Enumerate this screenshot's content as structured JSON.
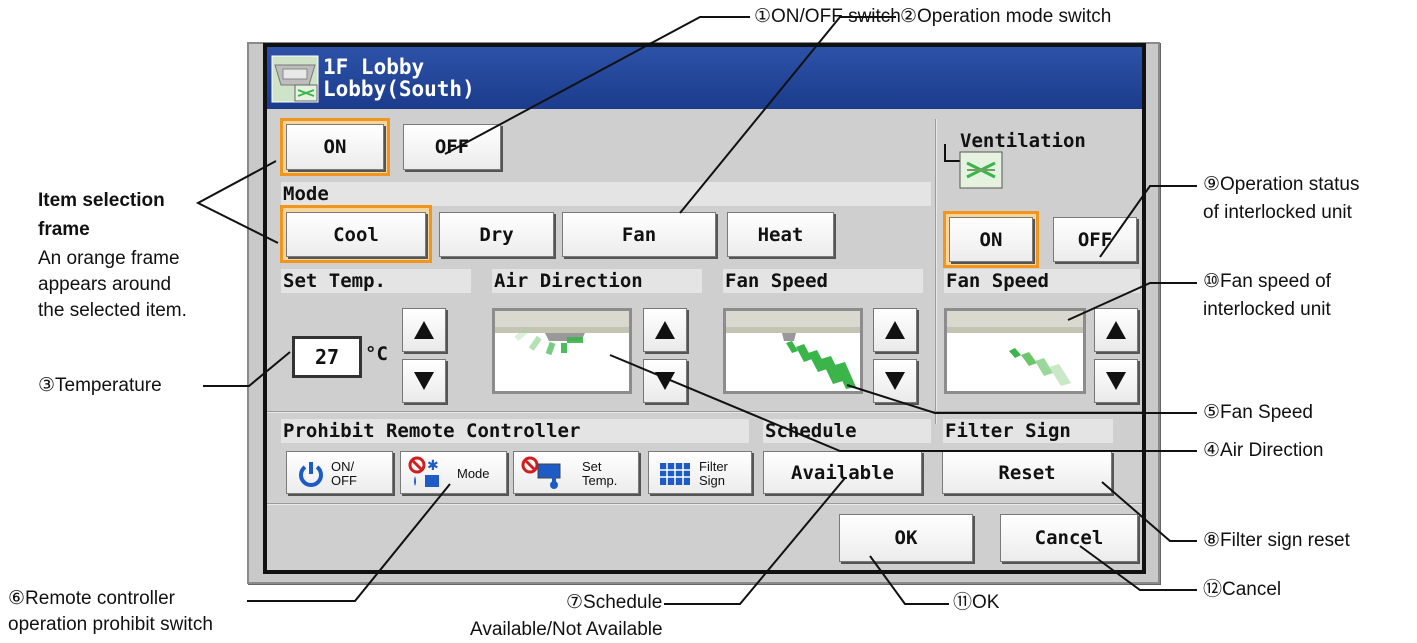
{
  "panel": {
    "title_line1": "1F Lobby",
    "title_line2": "Lobby(South)",
    "on_label": "ON",
    "off_label": "OFF",
    "mode_label": "Mode",
    "modes": [
      "Cool",
      "Dry",
      "Fan",
      "Heat"
    ],
    "selected_mode": "Cool",
    "set_temp_label": "Set Temp.",
    "temperature": "27",
    "temp_unit": "°C",
    "air_direction_label": "Air Direction",
    "fan_speed_label": "Fan Speed",
    "ventilation_label": "Ventilation",
    "vent_on_label": "ON",
    "vent_off_label": "OFF",
    "vent_fan_speed_label": "Fan Speed",
    "prohibit_label": "Prohibit Remote Controller",
    "prohibit_buttons": [
      {
        "line1": "ON/",
        "line2": "OFF",
        "icon": "power-icon"
      },
      {
        "line1": "Mode",
        "line2": "",
        "icon": "mode-prohibit-icon"
      },
      {
        "line1": "Set",
        "line2": "Temp.",
        "icon": "temp-prohibit-icon"
      },
      {
        "line1": "Filter",
        "line2": "Sign",
        "icon": "filter-icon"
      }
    ],
    "schedule_label": "Schedule",
    "schedule_value": "Available",
    "filter_sign_label": "Filter Sign",
    "filter_reset_label": "Reset",
    "ok_label": "OK",
    "cancel_label": "Cancel"
  },
  "annotations": {
    "a1": "①ON/OFF switch",
    "a2": "②Operation mode switch",
    "a3": "③Temperature",
    "a4": "④Air Direction",
    "a5": "⑤Fan Speed",
    "a6_line1": "⑥Remote controller",
    "a6_line2": "operation prohibit switch",
    "a7_line1": "⑦Schedule",
    "a7_line2": "Available/Not Available",
    "a8": "⑧Filter sign reset",
    "a9_line1": "⑨Operation status",
    "a9_line2": "of interlocked unit",
    "a10_line1": "⑩Fan speed of",
    "a10_line2": "interlocked unit",
    "a11": "⑪OK",
    "a12": "⑫Cancel",
    "frame_title_1": "Item selection",
    "frame_title_2": "frame",
    "frame_desc_1": "An orange frame",
    "frame_desc_2": "appears around",
    "frame_desc_3": "the selected item."
  },
  "colors": {
    "titlebar": "#1c3c8c",
    "selection_frame": "#f0961e",
    "airflow_green": "#3bb54a",
    "power_blue": "#1e5bc6",
    "prohibit_red": "#d11e1e"
  }
}
